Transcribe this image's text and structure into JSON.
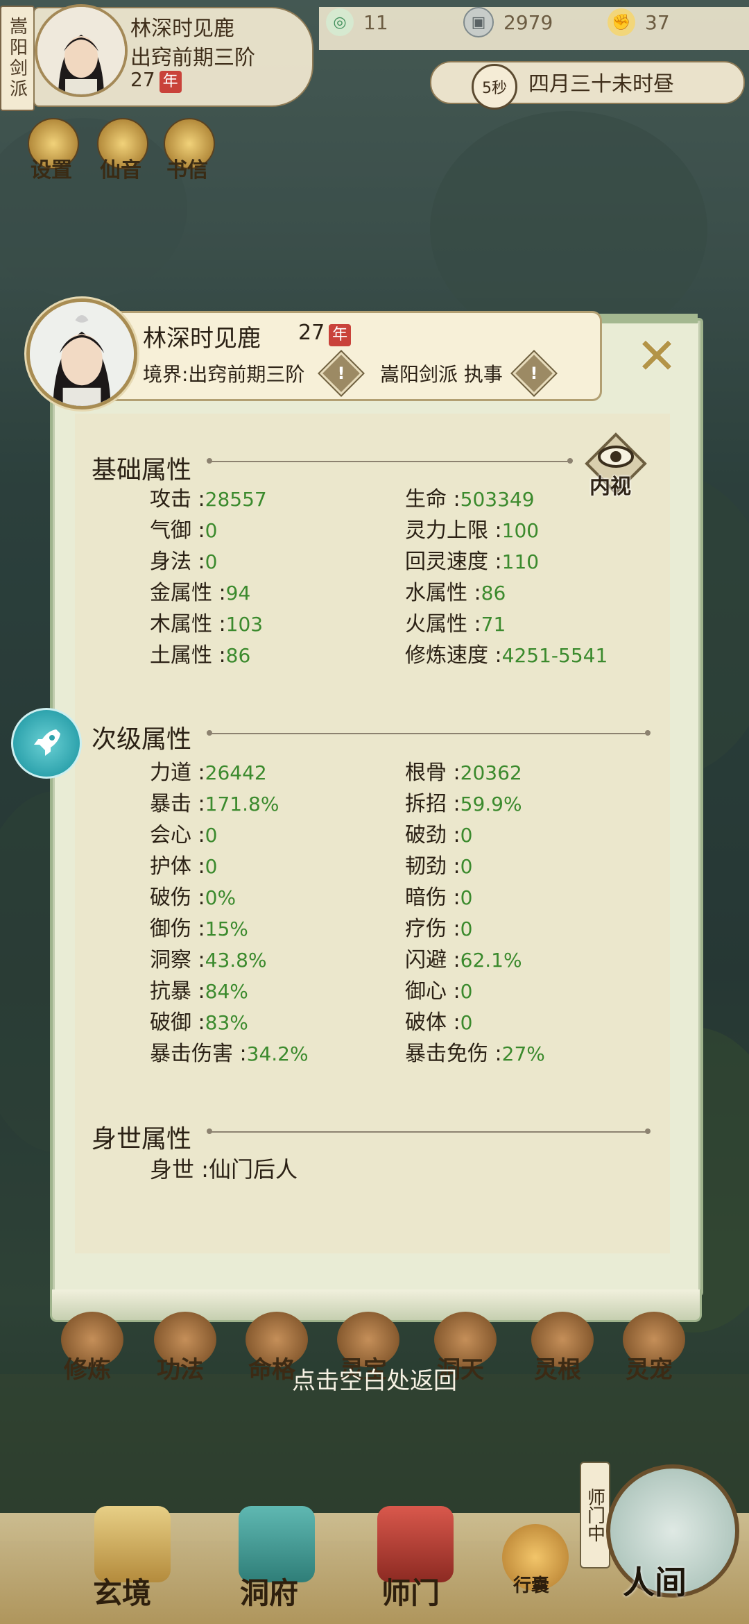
{
  "header": {
    "sect_tag": "嵩阳剑派",
    "player_name": "林深时见鹿",
    "realm": "出窍前期三阶",
    "age": "27",
    "age_unit": "年",
    "resources": [
      {
        "icon": "spirit-swirl-icon",
        "value": "11",
        "color": "#4aa06a"
      },
      {
        "icon": "coin-icon",
        "value": "2979",
        "color": "#7f8a8c"
      },
      {
        "icon": "muscle-icon",
        "value": "37",
        "color": "#d9a43a"
      }
    ],
    "timer": "5秒",
    "game_date": "四月三十未时昼",
    "quick_buttons": [
      "设置",
      "仙音",
      "书信"
    ]
  },
  "dialog": {
    "name": "林深时见鹿",
    "age": "27",
    "age_unit": "年",
    "realm_label": "境界:出窍前期三阶",
    "sect_label": "嵩阳剑派 执事",
    "info_mark": "!",
    "close_glyph": "✕",
    "insight_label": "内视",
    "sections": {
      "basic": {
        "title": "基础属性",
        "left": [
          {
            "label": "攻击 :",
            "value": "28557"
          },
          {
            "label": "气御 :",
            "value": "0"
          },
          {
            "label": "身法 :",
            "value": "0"
          },
          {
            "label": "金属性 :",
            "value": "94"
          },
          {
            "label": "木属性 :",
            "value": "103"
          },
          {
            "label": "土属性 :",
            "value": "86"
          }
        ],
        "right": [
          {
            "label": "生命 :",
            "value": "503349"
          },
          {
            "label": "灵力上限 :",
            "value": "100"
          },
          {
            "label": "回灵速度 :",
            "value": "110"
          },
          {
            "label": "水属性 :",
            "value": "86"
          },
          {
            "label": "火属性 :",
            "value": "71"
          },
          {
            "label": "修炼速度 :",
            "value": "4251-5541"
          }
        ]
      },
      "secondary": {
        "title": "次级属性",
        "left": [
          {
            "label": "力道 :",
            "value": "26442"
          },
          {
            "label": "暴击 :",
            "value": "171.8%"
          },
          {
            "label": "会心 :",
            "value": "0"
          },
          {
            "label": "护体 :",
            "value": "0"
          },
          {
            "label": "破伤 :",
            "value": "0%"
          },
          {
            "label": "御伤 :",
            "value": "15%"
          },
          {
            "label": "洞察 :",
            "value": "43.8%"
          },
          {
            "label": "抗暴 :",
            "value": "84%"
          },
          {
            "label": "破御 :",
            "value": "83%"
          },
          {
            "label": "暴击伤害 :",
            "value": "34.2%"
          }
        ],
        "right": [
          {
            "label": "根骨 :",
            "value": "20362"
          },
          {
            "label": "拆招 :",
            "value": "59.9%"
          },
          {
            "label": "破劲 :",
            "value": "0"
          },
          {
            "label": "韧劲 :",
            "value": "0"
          },
          {
            "label": "暗伤 :",
            "value": "0"
          },
          {
            "label": "疗伤 :",
            "value": "0"
          },
          {
            "label": "闪避 :",
            "value": "62.1%"
          },
          {
            "label": "御心 :",
            "value": "0"
          },
          {
            "label": "破体 :",
            "value": "0"
          },
          {
            "label": "暴击免伤 :",
            "value": "27%"
          }
        ]
      },
      "background": {
        "title": "身世属性",
        "label": "身世 :",
        "value": "仙门后人"
      }
    }
  },
  "menu_row": [
    "修炼",
    "功法",
    "命格",
    "灵宝",
    "洞天",
    "灵根",
    "灵宠"
  ],
  "back_hint": "点击空白处返回",
  "bottom_nav": {
    "items": [
      "玄境",
      "洞府",
      "师门"
    ],
    "pouch_label": "行囊",
    "sect_status": "师门中",
    "world_label": "人间"
  },
  "colors": {
    "value_green": "#3b8a2d",
    "panel_bg": "#ebe7cc",
    "panel_border": "#9fb38c",
    "accent_gold": "#b39447"
  }
}
